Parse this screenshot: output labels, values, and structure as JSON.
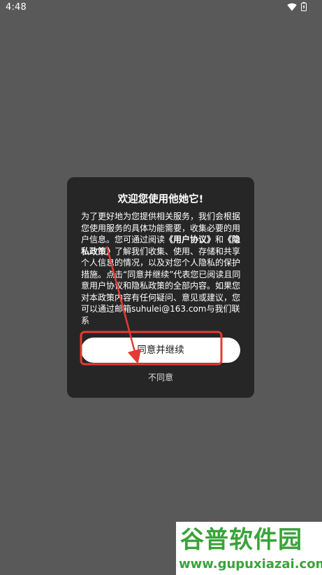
{
  "status_bar": {
    "time": "4:48",
    "icons": [
      "wifi-icon",
      "battery-icon"
    ]
  },
  "dialog": {
    "title": "欢迎您使用他她它!",
    "body": {
      "part1": "为了更好地为您提供相关服务，我们会根据您使用服务的具体功能需要，收集必要的用户信息。您可通过阅读",
      "user_agreement": "《用户协议》",
      "and": "和",
      "privacy_policy": "《隐私政策》",
      "part2": "了解我们收集、使用、存储和共享个人信息的情况，以及对您个人隐私的保护措施。点击“同意并继续”代表您已阅读且同意用户协议和隐私政策的全部内容。如果您对本政策内容有任何疑问、意见或建议，您可以通过邮箱suhulei@163.com与我们联系"
    },
    "agree_label": "同意并继续",
    "disagree_label": "不同意"
  },
  "annotation": {
    "color": "#e53935"
  },
  "watermark": {
    "logo_text": "谷普软件园",
    "url": "www.gupuxiazai.com",
    "color": "#3aa33a"
  }
}
